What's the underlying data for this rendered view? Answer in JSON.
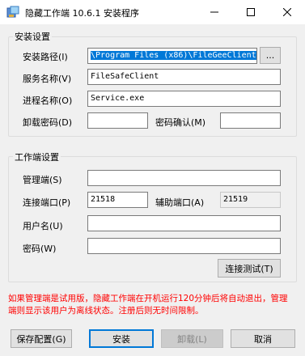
{
  "window": {
    "title": "隐藏工作端 10.6.1 安装程序"
  },
  "install_group": {
    "title": "安装设置",
    "path_label": "安装路径(I)",
    "path_value": "\\Program Files (x86)\\FileGeeClient",
    "browse_label": "...",
    "service_label": "服务名称(V)",
    "service_value": "FileSafeClient",
    "process_label": "进程名称(O)",
    "process_value": "Service.exe",
    "uninstall_pwd_label": "卸载密码(D)",
    "uninstall_pwd_value": "",
    "confirm_pwd_label": "密码确认(M)",
    "confirm_pwd_value": ""
  },
  "work_group": {
    "title": "工作端设置",
    "manager_label": "管理端(S)",
    "manager_value": "",
    "port_label": "连接端口(P)",
    "port_value": "21518",
    "aux_port_label": "辅助端口(A)",
    "aux_port_value": "21519",
    "user_label": "用户名(U)",
    "user_value": "",
    "pwd_label": "密码(W)",
    "pwd_value": "",
    "test_button": "连接测试(T)"
  },
  "warning_text": "如果管理端是试用版，隐藏工作端在开机运行120分钟后将自动退出，管理端则显示该用户为离线状态。注册后则无时间限制。",
  "footer": {
    "save_config": "保存配置(G)",
    "install": "安装",
    "uninstall": "卸载(L)",
    "cancel": "取消"
  },
  "colors": {
    "warning": "#ff0000",
    "selection": "#0078d7",
    "accent": "#0078d7"
  },
  "icons": {
    "app": "installer-icon",
    "minimize": "minimize-icon",
    "maximize": "maximize-icon",
    "close": "close-icon"
  }
}
